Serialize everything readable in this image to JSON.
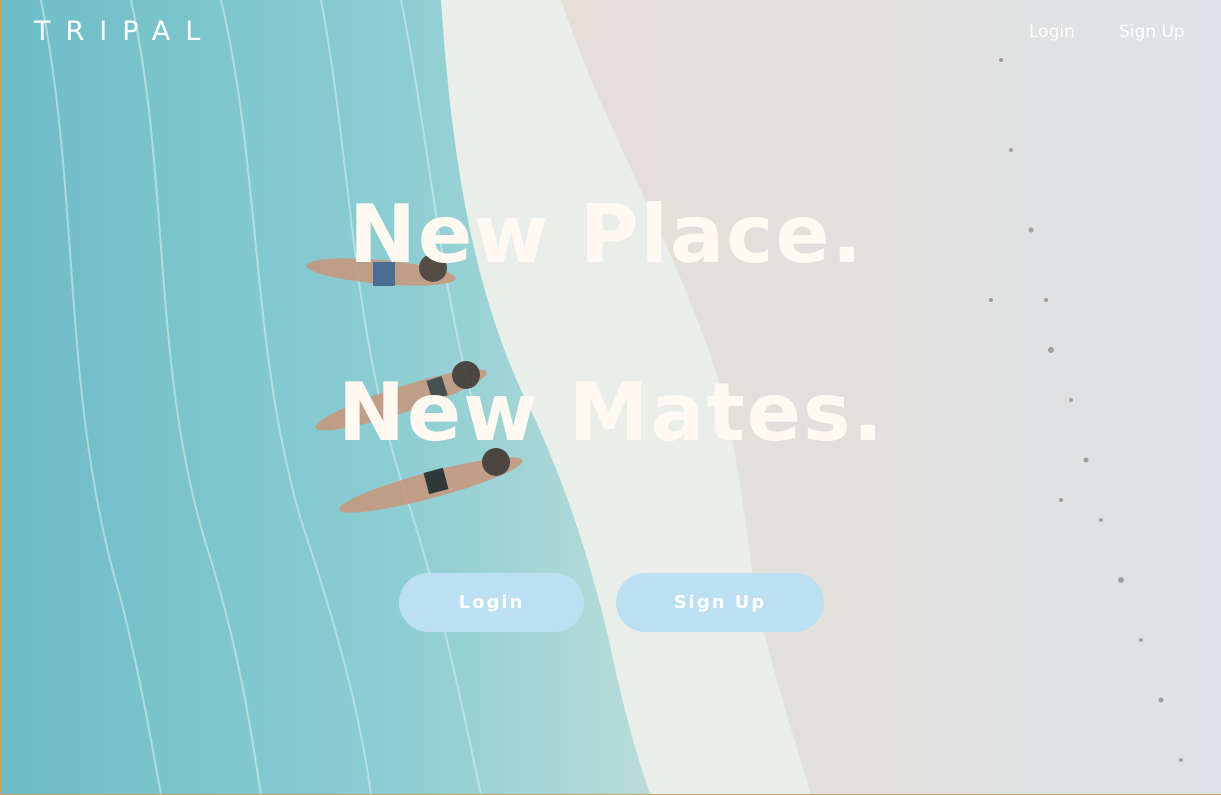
{
  "brand": {
    "name": "TRIPAL"
  },
  "nav": {
    "login_label": "Login",
    "signup_label": "Sign Up"
  },
  "hero": {
    "headline_line1": "New Place.",
    "headline_line2": "New Mates.",
    "login_button": "Login",
    "signup_button": "Sign Up",
    "background_image": "aerial-beach-photo-three-people-lying-in-shallow-water",
    "colors": {
      "water": "#7fc4cc",
      "sand": "#e6e0d8",
      "headline": "#fffaf1",
      "button": "#bcdff1"
    }
  }
}
